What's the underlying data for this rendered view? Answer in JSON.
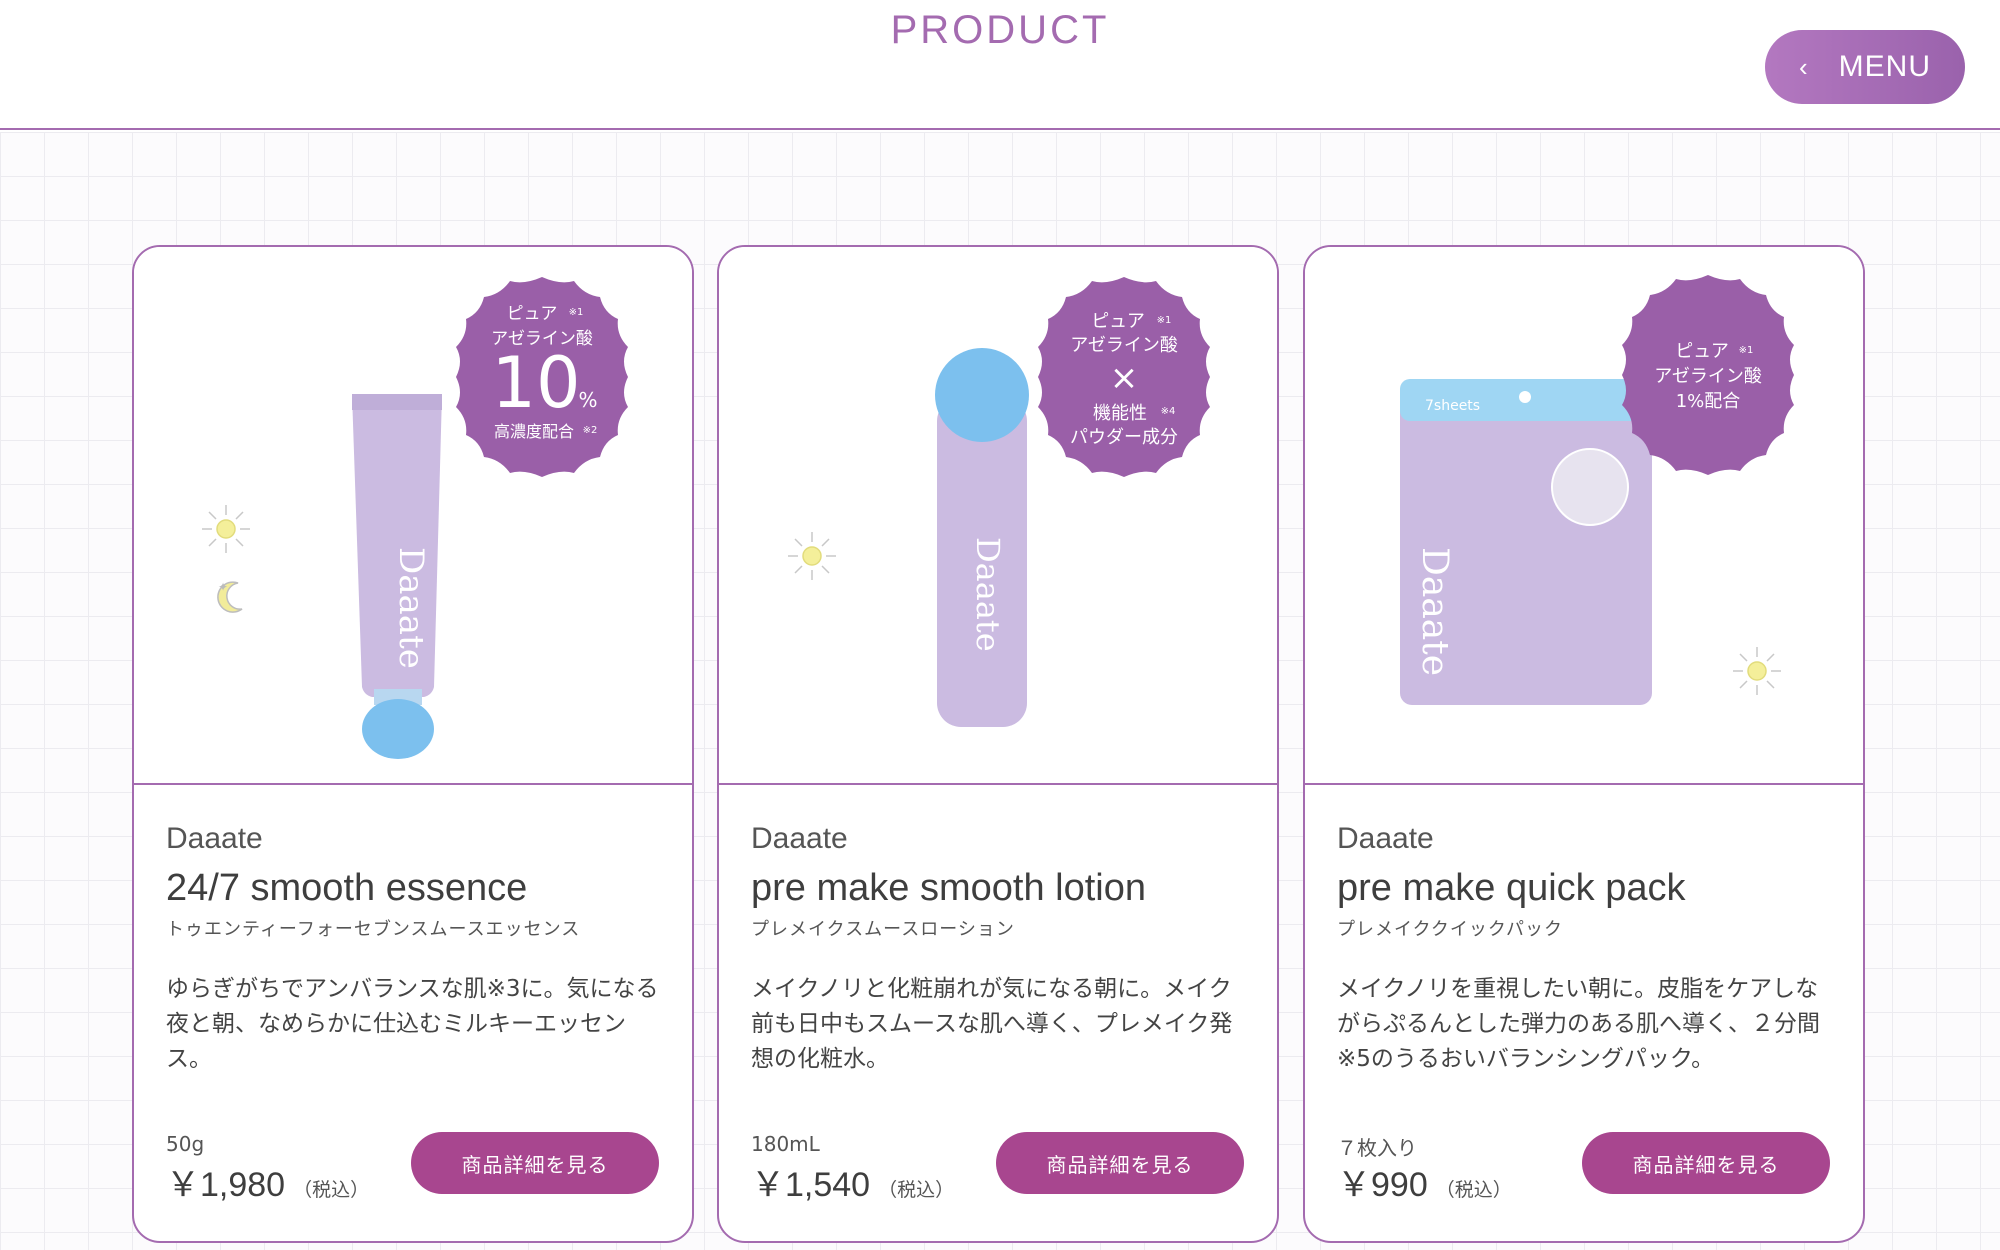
{
  "header": {
    "title": "PRODUCT",
    "menu_label": "MENU"
  },
  "colors": {
    "accent": "#a46bb0",
    "button": "#a8468f",
    "badge": "#9a5fa8",
    "product_lavender": "#cdbbe3",
    "product_blue": "#7cc0ee"
  },
  "products": [
    {
      "badge": {
        "line1": "ピュア",
        "line2": "アゼライン酸",
        "big": "10",
        "unit": "%",
        "line4": "高濃度配合",
        "note1": "※1",
        "note2": "※2"
      },
      "logo": "Daaate",
      "brand": "Daaate",
      "name": "24/7 smooth essence",
      "kana": "トゥエンティーフォーセブンスムースエッセンス",
      "description": "ゆらぎがちでアンバランスな肌※3に。気になる夜と朝、なめらかに仕込むミルキーエッセンス。",
      "size": "50g",
      "price": "￥1,980",
      "tax": "（税込）",
      "button": "商品詳細を見る"
    },
    {
      "badge": {
        "line1": "ピュア",
        "line2": "アゼライン酸",
        "cross": "×",
        "line4": "機能性",
        "line5": "パウダー成分",
        "note1": "※1",
        "note4": "※4"
      },
      "logo": "Daaate",
      "brand": "Daaate",
      "name": "pre make smooth lotion",
      "kana": "プレメイクスムースローション",
      "description": "メイクノリと化粧崩れが気になる朝に。メイク前も日中もスムースな肌へ導く、プレメイク発想の化粧水。",
      "size": "180mL",
      "price": "￥1,540",
      "tax": "（税込）",
      "button": "商品詳細を見る"
    },
    {
      "badge": {
        "line1": "ピュア",
        "line2": "アゼライン酸",
        "line3": "1%配合",
        "note1": "※1"
      },
      "logo": "Daaate",
      "pack_label": "7sheets",
      "brand": "Daaate",
      "name": "pre make quick pack",
      "kana": "プレメイククイックパック",
      "description": "メイクノリを重視したい朝に。皮脂をケアしながらぷるんとした弾力のある肌へ導く、２分間※5のうるおいバランシングパック。",
      "size": "７枚入り",
      "price": "￥990",
      "tax": "（税込）",
      "button": "商品詳細を見る"
    }
  ]
}
